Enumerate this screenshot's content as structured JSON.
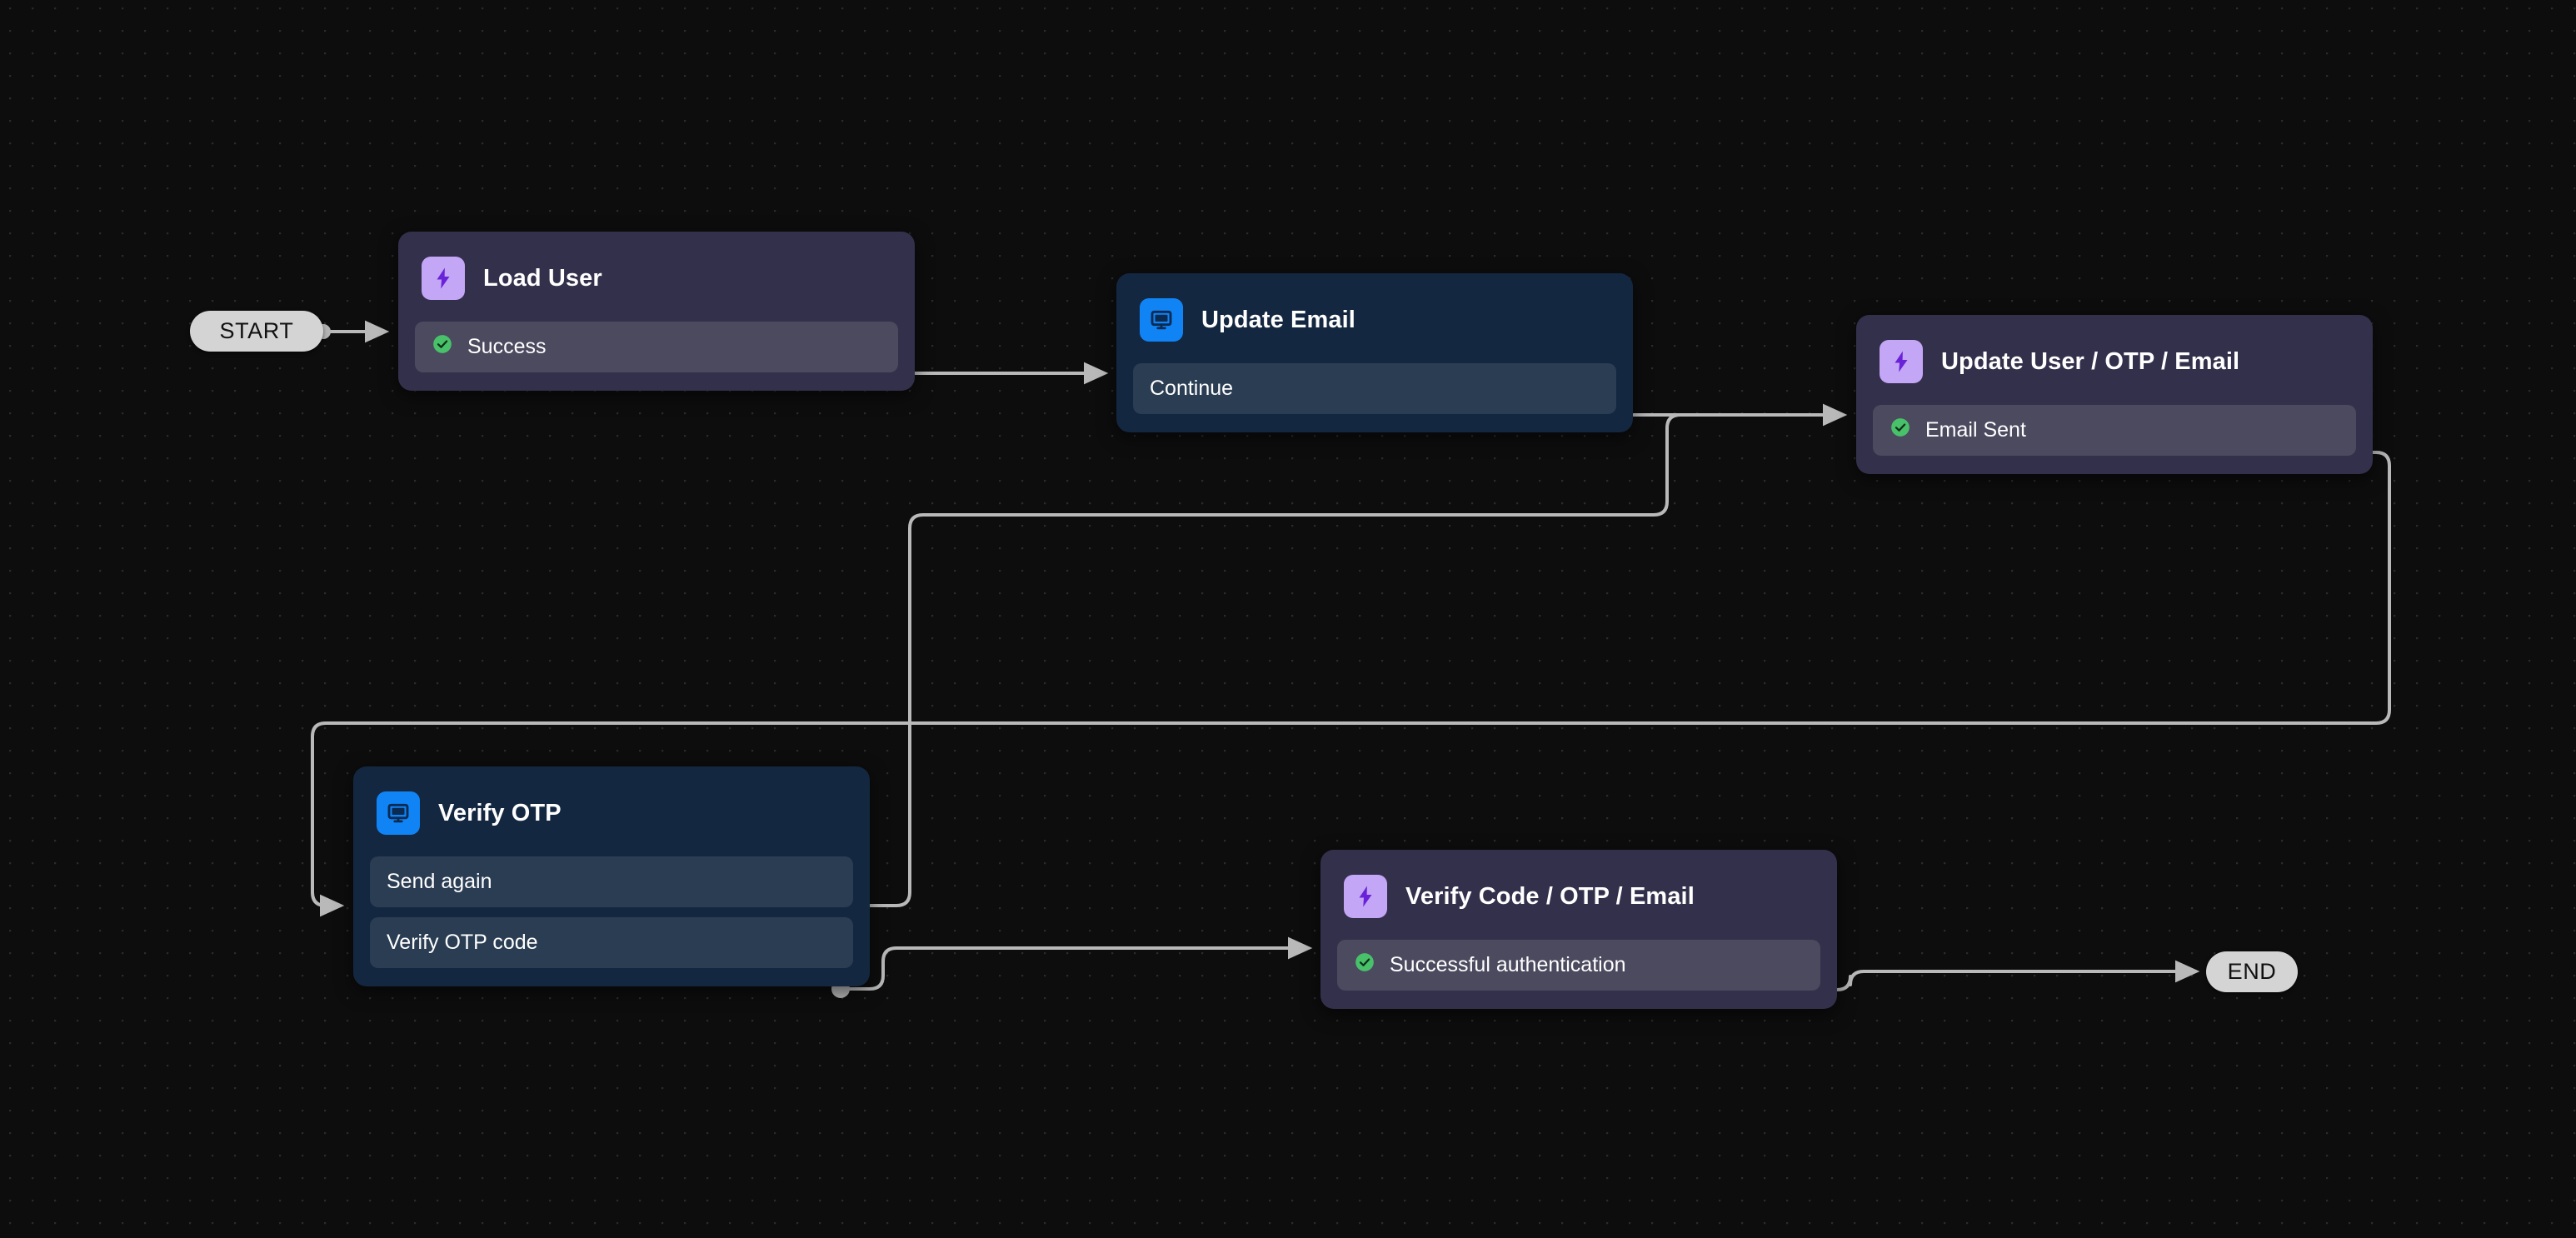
{
  "canvas": {
    "background_color": "#0d0d0d",
    "grid": "dot-grid"
  },
  "terminals": [
    {
      "id": "start",
      "label": "START"
    },
    {
      "id": "end",
      "label": "END"
    }
  ],
  "nodes": [
    {
      "id": "load-user",
      "title": "Load User",
      "kind": "function",
      "icon": "lightning-bolt-icon",
      "accent": "#c3a6f5",
      "body_color": "#33304b",
      "actions": [
        {
          "label": "Success",
          "status": "success",
          "status_color": "#49c16a"
        }
      ]
    },
    {
      "id": "update-email",
      "title": "Update Email",
      "kind": "screen",
      "icon": "monitor-icon",
      "accent": "#1184f5",
      "body_color": "#142740",
      "actions": [
        {
          "label": "Continue",
          "status": "none",
          "status_color": ""
        }
      ]
    },
    {
      "id": "update-user-otp-email",
      "title": "Update User / OTP / Email",
      "kind": "function",
      "icon": "lightning-bolt-icon",
      "accent": "#c3a6f5",
      "body_color": "#33304b",
      "actions": [
        {
          "label": "Email Sent",
          "status": "success",
          "status_color": "#49c16a"
        }
      ]
    },
    {
      "id": "verify-otp",
      "title": "Verify OTP",
      "kind": "screen",
      "icon": "monitor-icon",
      "accent": "#1184f5",
      "body_color": "#142740",
      "actions": [
        {
          "label": "Send again",
          "status": "none",
          "status_color": ""
        },
        {
          "label": "Verify OTP code",
          "status": "none",
          "status_color": ""
        }
      ]
    },
    {
      "id": "verify-code-otp-email",
      "title": "Verify Code / OTP / Email",
      "kind": "function",
      "icon": "lightning-bolt-icon",
      "accent": "#c3a6f5",
      "body_color": "#33304b",
      "actions": [
        {
          "label": "Successful authentication",
          "status": "success",
          "status_color": "#49c16a"
        }
      ]
    }
  ],
  "edges": [
    {
      "id": "start-to-load-user",
      "from": "start",
      "to": "load-user"
    },
    {
      "id": "load-user-success-to-update-email",
      "from": "load-user.Success",
      "to": "update-email"
    },
    {
      "id": "update-email-continue-to-update-user",
      "from": "update-email.Continue",
      "to": "update-user-otp-email"
    },
    {
      "id": "update-user-email-sent-to-verify-otp",
      "from": "update-user-otp-email.Email Sent",
      "to": "verify-otp"
    },
    {
      "id": "verify-otp-send-again-to-update-user",
      "from": "verify-otp.Send again",
      "to": "update-user-otp-email"
    },
    {
      "id": "verify-otp-code-to-verify-code",
      "from": "verify-otp.Verify OTP code",
      "to": "verify-code-otp-email"
    },
    {
      "id": "verify-code-success-to-end",
      "from": "verify-code-otp-email.Successful authentication",
      "to": "end"
    }
  ],
  "edge_style": {
    "stroke": "#b9b9b9",
    "width": 4
  }
}
